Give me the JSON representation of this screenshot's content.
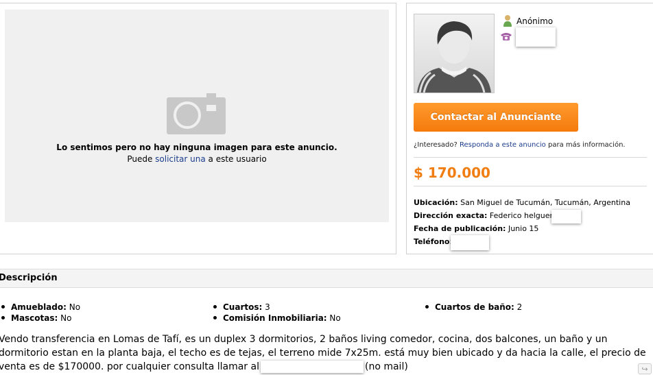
{
  "photo": {
    "no_image_message": "Lo sentimos pero no hay ninguna imagen para este anuncio.",
    "request_prefix": "Puede ",
    "request_link": "solicitar una",
    "request_suffix": " a este usuario"
  },
  "seller": {
    "name": "Anónimo",
    "contact_button": "Contactar al Anunciante",
    "interest_prefix": "¿Interesado? ",
    "interest_link": "Responda a este anuncio",
    "interest_suffix": " para más información."
  },
  "listing": {
    "price": "$ 170.000",
    "location_label": "Ubicación:",
    "location_value": " San Miguel de Tucumán, Tucumán, Argentina",
    "address_label": "Dirección exacta:",
    "address_value": " Federico helguera",
    "date_label": "Fecha de publicación:",
    "date_value": " Junio 15",
    "phone_label": "Teléfono:"
  },
  "description": {
    "title": "Descripción",
    "features": [
      {
        "label": "Amueblado:",
        "value": " No"
      },
      {
        "label": "Mascotas:",
        "value": " No"
      },
      {
        "label": "Cuartos:",
        "value": " 3"
      },
      {
        "label": "Comisión Inmobiliaria:",
        "value": " No"
      },
      {
        "label": "Cuartos de baño:",
        "value": " 2"
      }
    ],
    "text_part1": "Vendo transferencia en Lomas de Tafí, es un duplex 3 dormitorios, 2 baños living comedor, cocina, dos balcones, un baño y un dormitorio estan en la planta baja, el techo es de tejas, el terreno mide 7x25m. está muy bien ubicado y da hacia la calle, el precio de venta es de $170000. por cualquier consulta llamar al",
    "text_part2": "(no mail)"
  },
  "icons": {
    "camera": "camera-icon",
    "user": "user-icon",
    "phone": "phone-icon",
    "share": "share-icon"
  },
  "colors": {
    "accent": "#f57a0c",
    "price": "#f07e13",
    "link": "#1a3c8c"
  }
}
